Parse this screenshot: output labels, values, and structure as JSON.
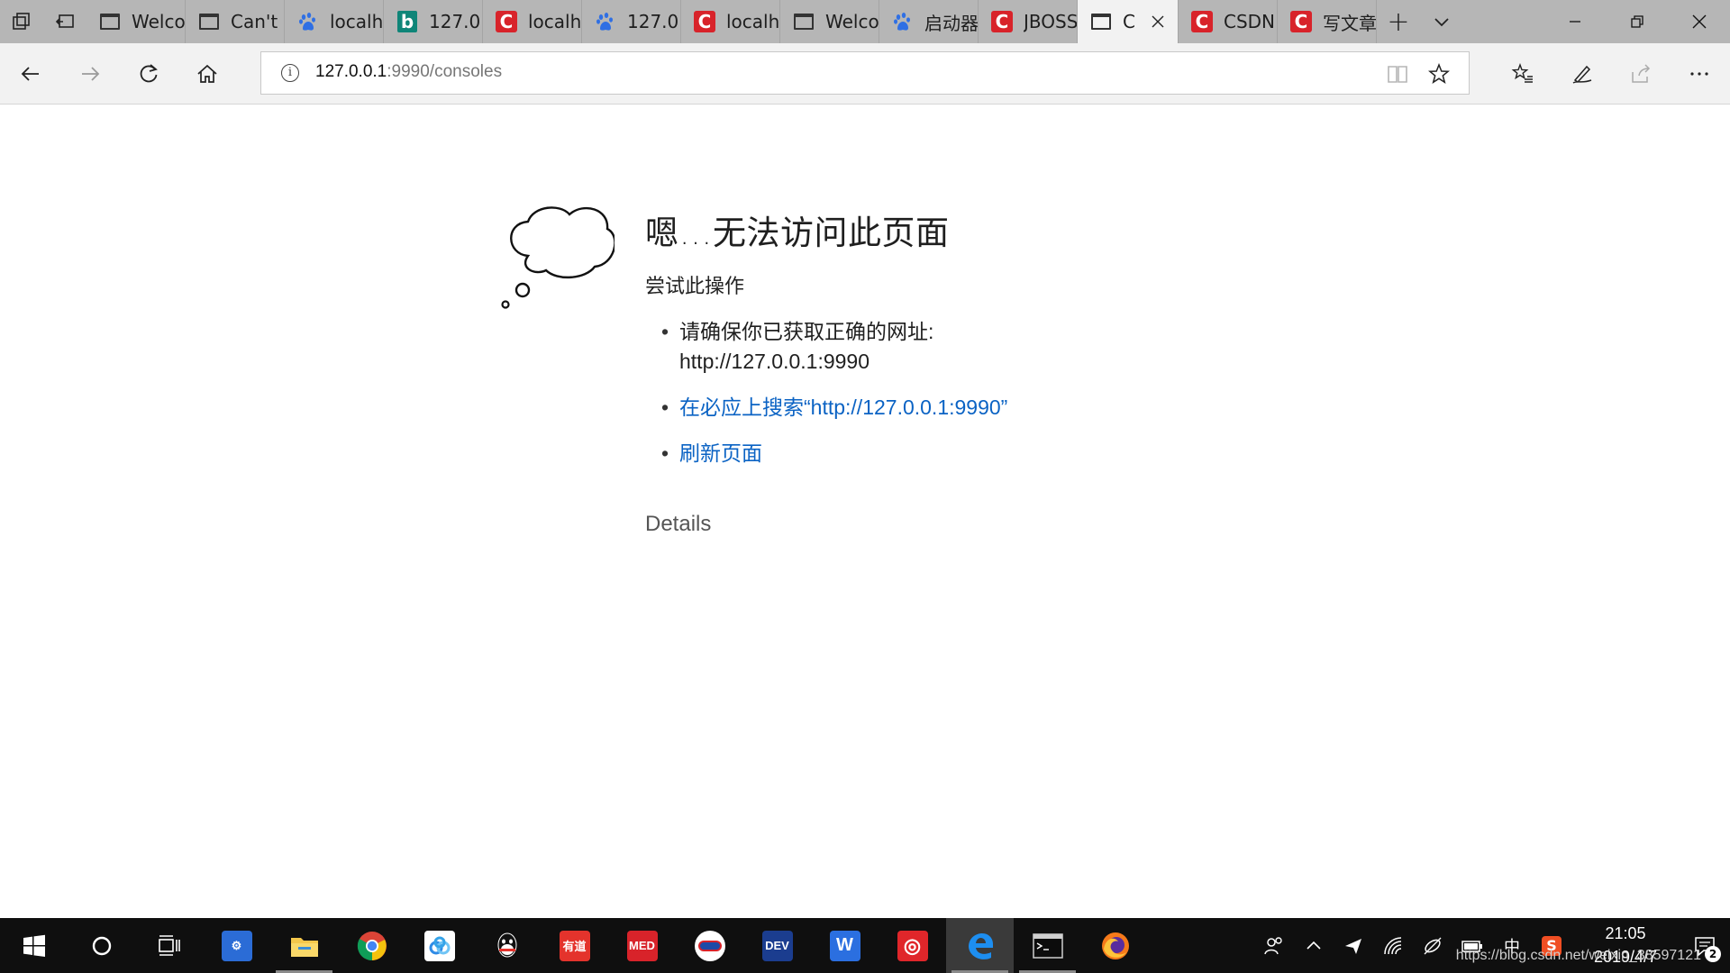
{
  "tabs": [
    {
      "label": "Welco",
      "icon": "page-icon"
    },
    {
      "label": "Can't",
      "icon": "page-icon"
    },
    {
      "label": "localh",
      "icon": "baidu-paw-icon"
    },
    {
      "label": "127.0",
      "icon": "bing-icon"
    },
    {
      "label": "localh",
      "icon": "csdn-icon"
    },
    {
      "label": "127.0",
      "icon": "baidu-paw-icon"
    },
    {
      "label": "localh",
      "icon": "csdn-icon"
    },
    {
      "label": "Welco",
      "icon": "page-icon"
    },
    {
      "label": "启动器",
      "icon": "baidu-paw-icon"
    },
    {
      "label": "JBOSS",
      "icon": "csdn-icon"
    },
    {
      "label": "C",
      "icon": "page-icon",
      "active": true
    },
    {
      "label": "CSDN",
      "icon": "csdn-icon"
    },
    {
      "label": "写文章",
      "icon": "csdn-icon"
    }
  ],
  "address": {
    "host": "127.0.0.1",
    "rest": ":9990/consoles"
  },
  "error": {
    "title": "嗯…无法访问此页面",
    "try": "尝试此操作",
    "suggestion1_line1": "请确保你已获取正确的网址:",
    "suggestion1_line2": "http://127.0.0.1:9990",
    "suggestion2": "在必应上搜索“http://127.0.0.1:9990”",
    "suggestion3": "刷新页面",
    "details": "Details"
  },
  "taskbar": {
    "apps": [
      "start",
      "cortana",
      "task-view",
      "network-tool",
      "file-explorer",
      "chrome",
      "baidu-netdisk",
      "qq",
      "youdao",
      "med",
      "mermaid",
      "devc",
      "wps",
      "netease-music",
      "edge",
      "terminal",
      "firefox"
    ],
    "apps_text": {
      "youdao": "有道",
      "med": "MED",
      "devc": "DEV"
    },
    "ime": "中",
    "time": "21:05",
    "date": "2019/4/7",
    "notifications": "2"
  },
  "watermark": "https://blog.csdn.net/weixin_38597121",
  "colors": {
    "link": "#0b63c4",
    "tabstrip": "#b6b6b6",
    "taskbar": "#0f0f0f",
    "csdn": "#d8232a"
  }
}
